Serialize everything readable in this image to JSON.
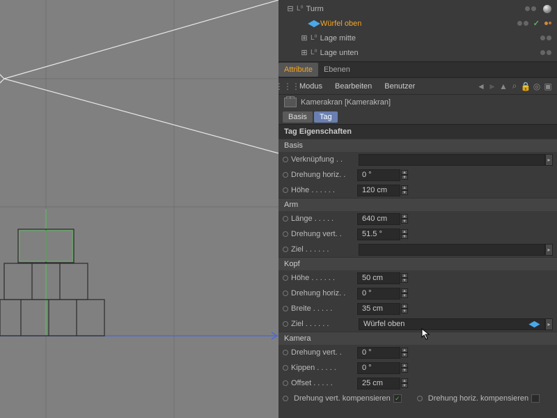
{
  "hierarchy": {
    "items": [
      {
        "label": "Turm",
        "indent": 0,
        "type": "null",
        "expand": "-",
        "selected": false,
        "tags": [
          "sphere"
        ]
      },
      {
        "label": "Würfel oben",
        "indent": 1,
        "type": "cube",
        "expand": "",
        "selected": true,
        "tags": [
          "check",
          "dots"
        ]
      },
      {
        "label": "Lage mitte",
        "indent": 1,
        "type": "null",
        "expand": "+",
        "selected": false,
        "tags": []
      },
      {
        "label": "Lage unten",
        "indent": 1,
        "type": "null",
        "expand": "+",
        "selected": false,
        "tags": []
      }
    ]
  },
  "tabs": {
    "attribute": "Attribute",
    "ebenen": "Ebenen"
  },
  "toolbar": {
    "modus": "Modus",
    "bearbeiten": "Bearbeiten",
    "benutzer": "Benutzer"
  },
  "object": {
    "name": "Kamerakran [Kamerakran]"
  },
  "subtabs": {
    "basis": "Basis",
    "tag": "Tag"
  },
  "section": {
    "title": "Tag Eigenschaften"
  },
  "groups": {
    "basis": {
      "title": "Basis",
      "props": {
        "verknuepfung": {
          "label": "Verknüpfung",
          "value": ""
        },
        "drehung_horiz": {
          "label": "Drehung horiz.",
          "value": "0 °"
        },
        "hoehe": {
          "label": "Höhe",
          "value": "120 cm"
        }
      }
    },
    "arm": {
      "title": "Arm",
      "props": {
        "laenge": {
          "label": "Länge",
          "value": "640 cm"
        },
        "drehung_vert": {
          "label": "Drehung vert.",
          "value": "51.5 °"
        },
        "ziel": {
          "label": "Ziel",
          "value": ""
        }
      }
    },
    "kopf": {
      "title": "Kopf",
      "props": {
        "hoehe": {
          "label": "Höhe",
          "value": "50 cm"
        },
        "drehung_horiz": {
          "label": "Drehung horiz.",
          "value": "0 °"
        },
        "breite": {
          "label": "Breite",
          "value": "35 cm"
        },
        "ziel": {
          "label": "Ziel",
          "value": "Würfel oben"
        }
      }
    },
    "kamera": {
      "title": "Kamera",
      "props": {
        "drehung_vert": {
          "label": "Drehung vert.",
          "value": "0 °"
        },
        "kippen": {
          "label": "Kippen",
          "value": "0 °"
        },
        "offset": {
          "label": "Offset",
          "value": "25 cm"
        }
      }
    }
  },
  "bottom": {
    "drehung_vert_komp": "Drehung vert. kompensieren",
    "drehung_horiz_komp": "Drehung horiz. kompensieren"
  }
}
